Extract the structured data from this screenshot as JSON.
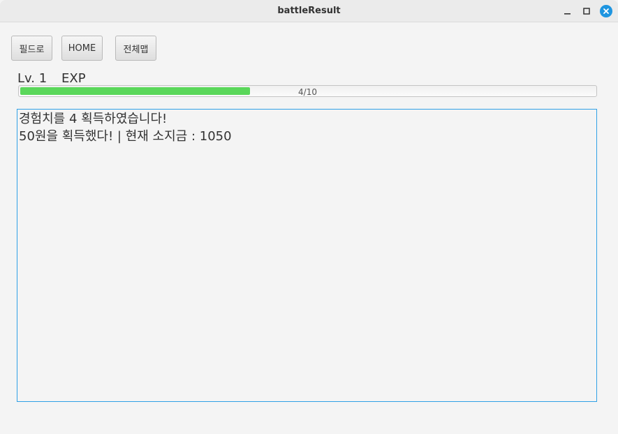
{
  "window": {
    "title": "battleResult"
  },
  "toolbar": {
    "field_label": "필드로",
    "home_label": "HOME",
    "map_label": "전체맵"
  },
  "status": {
    "level": "Lv. 1",
    "exp_label": "EXP",
    "progress_text": "4/10",
    "progress_value": 0.4
  },
  "log": {
    "lines": [
      "경험치를 4 획득하였습니다!",
      "50원을 획득했다! | 현재 소지금 : 1050"
    ]
  },
  "colors": {
    "progress_fill": "#5ad75a",
    "focus_border": "#2fa0e6",
    "close_button": "#1e95e0"
  },
  "icons": {
    "minimize": "minimize-icon",
    "maximize": "maximize-icon",
    "close": "close-icon"
  }
}
